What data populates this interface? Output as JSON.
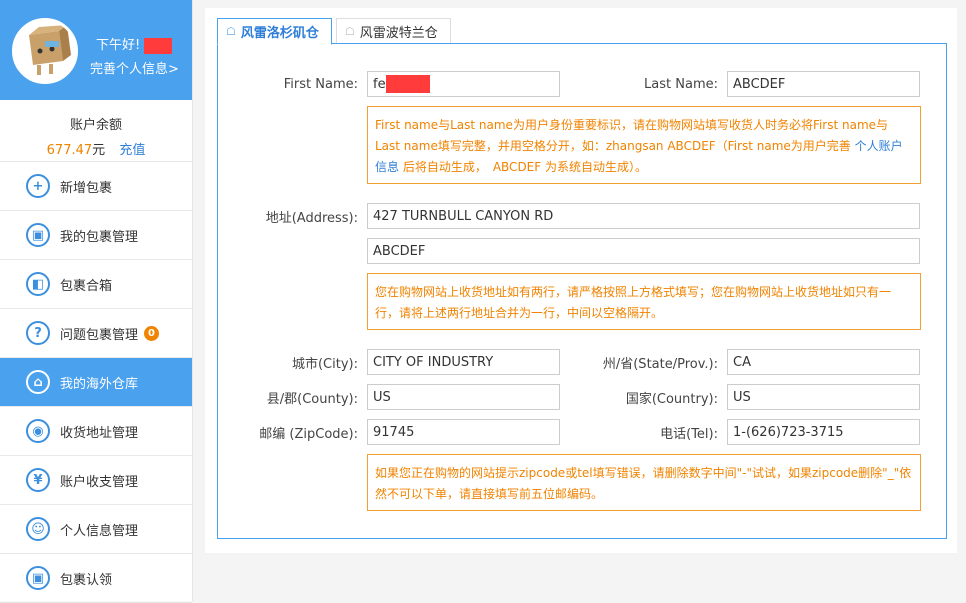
{
  "sidebar": {
    "greeting": "下午好!",
    "profile_link": "完善个人信息>",
    "balance_title": "账户余额",
    "balance_amount": "677.47",
    "balance_unit": "元",
    "recharge": "充值",
    "items": [
      {
        "label": "新增包裹",
        "icon": "+"
      },
      {
        "label": "我的包裹管理",
        "icon": "▣"
      },
      {
        "label": "包裹合箱",
        "icon": "◧"
      },
      {
        "label": "问题包裹管理",
        "icon": "?",
        "badge": "0"
      },
      {
        "label": "我的海外仓库",
        "icon": "⌂"
      },
      {
        "label": "收货地址管理",
        "icon": "◉"
      },
      {
        "label": "账户收支管理",
        "icon": "¥"
      },
      {
        "label": "个人信息管理",
        "icon": "☺"
      },
      {
        "label": "包裹认领",
        "icon": "▣"
      }
    ]
  },
  "tabs": [
    {
      "label": "风雷洛杉矶仓"
    },
    {
      "label": "风雷波特兰仓"
    }
  ],
  "form": {
    "first_name_label": "First Name:",
    "first_name_value": "fe",
    "last_name_label": "Last Name:",
    "last_name_value": "ABCDEF",
    "name_note_1": "First name与Last name为用户身份重要标识，请在购物网站填写收货人时务必将First name与Last name填写完整，并用空格分开，如：zhangsan ABCDEF（First name为用户完善 ",
    "name_note_link": "个人账户信息",
    "name_note_2": " 后将自动生成，　ABCDEF 为系统自动生成）。",
    "address_label": "地址(Address):",
    "address_line1": "427 TURNBULL CANYON RD",
    "address_line2": "ABCDEF",
    "address_note": "您在购物网站上收货地址如有两行，请严格按照上方格式填写；您在购物网站上收货地址如只有一行，请将上述两行地址合并为一行，中间以空格隔开。",
    "city_label": "城市(City):",
    "city_value": "CITY OF INDUSTRY",
    "state_label": "州/省(State/Prov.):",
    "state_value": "CA",
    "county_label": "县/郡(County):",
    "county_value": "US",
    "country_label": "国家(Country):",
    "country_value": "US",
    "zip_label": "邮编 (ZipCode):",
    "zip_value": "91745",
    "tel_label": "电话(Tel):",
    "tel_value": "1-(626)723-3715",
    "zip_note": "如果您正在购物的网站提示zipcode或tel填写错误，请删除数字中间\"-\"试试，如果zipcode删除\"_\"依然不可以下单，请直接填写前五位邮编码。"
  },
  "colors": {
    "accent": "#4aa1ee",
    "warning": "#f08300",
    "link": "#2f7fd8"
  }
}
